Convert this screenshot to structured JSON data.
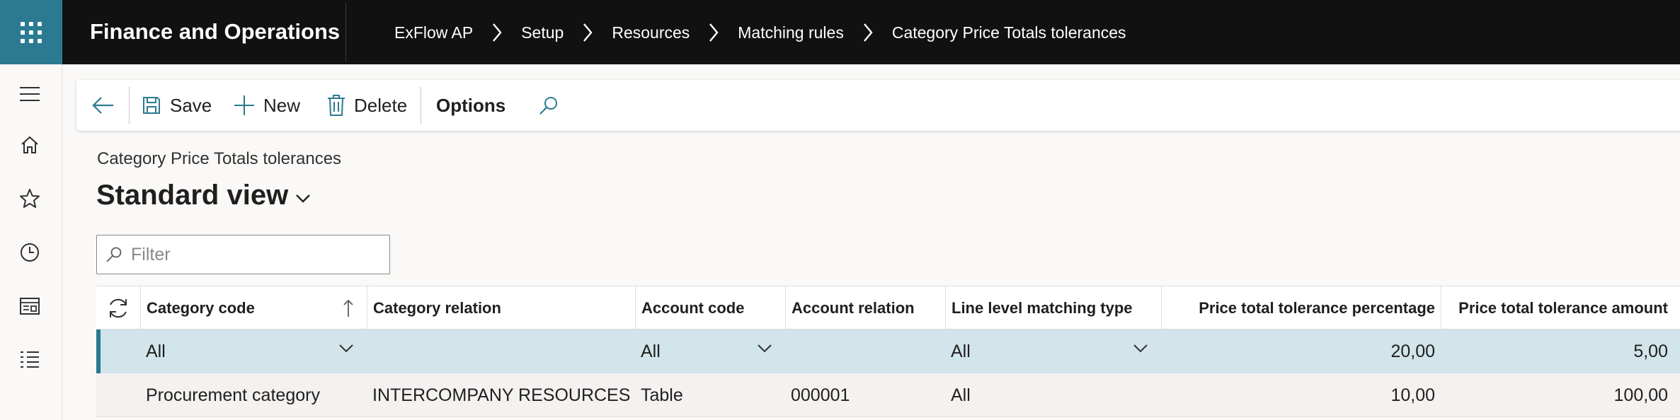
{
  "app": {
    "title": "Finance and Operations"
  },
  "breadcrumb": [
    "ExFlow AP",
    "Setup",
    "Resources",
    "Matching rules",
    "Category Price Totals tolerances"
  ],
  "toolbar": {
    "save_label": "Save",
    "new_label": "New",
    "delete_label": "Delete",
    "options_label": "Options"
  },
  "page": {
    "caption": "Category Price Totals tolerances",
    "view_name": "Standard view"
  },
  "filter": {
    "placeholder": "Filter",
    "value": ""
  },
  "grid": {
    "columns": [
      "Category code",
      "Category relation",
      "Account code",
      "Account relation",
      "Line level matching type",
      "Price total tolerance percentage",
      "Price total tolerance amount"
    ],
    "sort": {
      "column": "Category code",
      "direction": "ascending"
    },
    "rows": [
      [
        "All",
        "",
        "All",
        "",
        "All",
        "20,00",
        "5,00"
      ],
      [
        "Procurement category",
        "INTERCOMPANY RESOURCES",
        "Table",
        "000001",
        "All",
        "10,00",
        "100,00"
      ]
    ],
    "selected_row": 0
  },
  "colors": {
    "header_bg": "#111111",
    "accent": "#2b7a91",
    "selected_row_bg": "#d1e5ea"
  },
  "icons": [
    "app-launcher-icon",
    "chevron-right-icon",
    "hamburger-icon",
    "home-icon",
    "star-icon",
    "clock-icon",
    "workspace-icon",
    "list-icon",
    "back-arrow-icon",
    "save-icon",
    "plus-icon",
    "trash-icon",
    "search-icon",
    "chevron-down-icon",
    "refresh-icon",
    "sort-up-icon"
  ]
}
